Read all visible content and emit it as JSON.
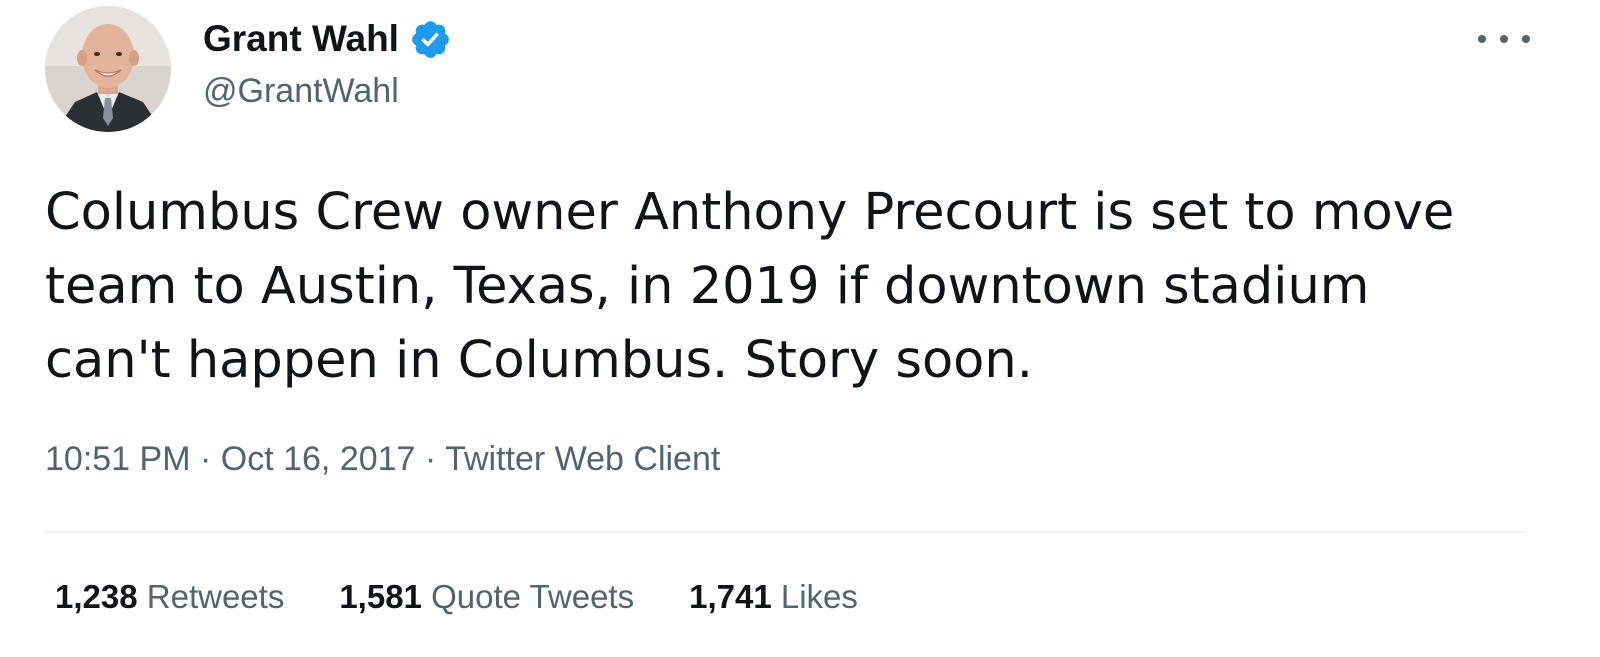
{
  "author": {
    "display_name": "Grant Wahl",
    "handle": "@GrantWahl",
    "verified": true,
    "avatar_icon": "profile-photo"
  },
  "tweet": {
    "text_lines": [
      "Columbus Crew owner Anthony Precourt is set to move",
      "team to Austin, Texas, in 2019 if downtown stadium",
      "can't happen in Columbus. Story soon."
    ],
    "time": "10:51 PM",
    "separator": "·",
    "date": "Oct 16, 2017",
    "source": "Twitter Web Client"
  },
  "stats": [
    {
      "count": "1,238",
      "label": "Retweets"
    },
    {
      "count": "1,581",
      "label": "Quote Tweets"
    },
    {
      "count": "1,741",
      "label": "Likes"
    }
  ],
  "colors": {
    "primary_text": "#0f1419",
    "secondary_text": "#536471",
    "verified_blue": "#1d9bf0",
    "divider": "#eff3f4"
  }
}
